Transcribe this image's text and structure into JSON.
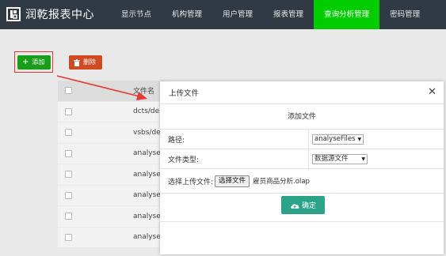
{
  "brand": {
    "title": "润乾报表中心",
    "icon": "report-logo-icon"
  },
  "nav": {
    "items": [
      {
        "label": "显示节点"
      },
      {
        "label": "机构管理"
      },
      {
        "label": "用户管理"
      },
      {
        "label": "报表管理"
      },
      {
        "label": "查询分析管理",
        "active": true
      },
      {
        "label": "密码管理"
      }
    ]
  },
  "toolbar": {
    "add_label": "添加",
    "add_icon": "plus-icon",
    "delete_label": "删除",
    "delete_icon": "trash-icon"
  },
  "table": {
    "header": "文件名",
    "rows": [
      "dcts/de",
      "vsbs/de",
      "analyse",
      "analyse",
      "analyse",
      "analyse",
      "analyse"
    ]
  },
  "modal": {
    "title": "上传文件",
    "close": "✕",
    "section_title": "添加文件",
    "path_label": "路径:",
    "path_value": "analyseFiles",
    "type_label": "文件类型:",
    "type_value": "数据源文件",
    "upload_label": "选择上传文件:",
    "choose_file_label": "选择文件",
    "file_name": "雇员商品分析.olap",
    "confirm_label": "确定",
    "confirm_icon": "cloud-upload-icon"
  },
  "colors": {
    "topbar": "#2f3a45",
    "nav_active": "#00cc00",
    "add_button": "#1a9d1a",
    "delete_button": "#d04a22",
    "confirm_button": "#2aa389",
    "annotation_red": "#e53935"
  }
}
